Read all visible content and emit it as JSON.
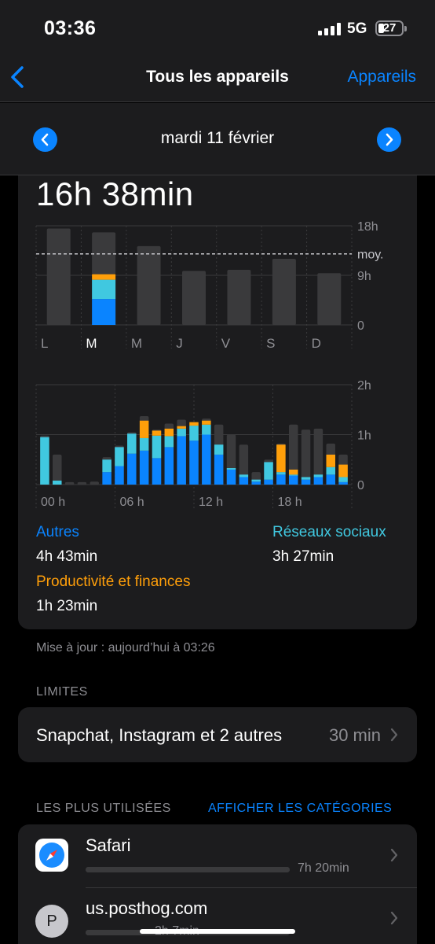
{
  "status": {
    "time": "03:36",
    "network": "5G",
    "battery": "27"
  },
  "nav": {
    "title": "Tous les appareils",
    "right": "Appareils"
  },
  "date": {
    "label": "mardi 11 février"
  },
  "summary": {
    "total": "16h 38min"
  },
  "weekly": {
    "y_ticks": [
      "18h",
      "9h",
      "0"
    ],
    "avg_label": "moy.",
    "days": [
      "L",
      "M",
      "M",
      "J",
      "V",
      "S",
      "D"
    ]
  },
  "hourly": {
    "y_ticks": [
      "2h",
      "1h",
      "0"
    ],
    "x_ticks": [
      "00 h",
      "06 h",
      "12 h",
      "18 h"
    ]
  },
  "legend": {
    "autres_label": "Autres",
    "autres_value": "4h 43min",
    "social_label": "Réseaux sociaux",
    "social_value": "3h 27min",
    "prod_label": "Productivité et finances",
    "prod_value": "1h 23min"
  },
  "updated": "Mise à jour : aujourd’hui à 03:26",
  "limits": {
    "header": "LIMITES",
    "text": "Snapchat, Instagram et 2 autres",
    "value": "30 min"
  },
  "most_used": {
    "header": "LES PLUS UTILISÉES",
    "link": "AFFICHER LES CATÉGORIES",
    "apps": [
      {
        "name": "Safari",
        "time": "7h 20min",
        "share": 1.0
      },
      {
        "name": "us.posthog.com",
        "time": "2h 7min",
        "share": 0.35,
        "initial": "P"
      }
    ]
  },
  "colors": {
    "accent": "#0a84ff",
    "blue": "#0a84ff",
    "cyan": "#40c8e0",
    "orange": "#ff9f0a",
    "gray": "#3a3a3c"
  },
  "chart_data": [
    {
      "type": "bar",
      "categories": [
        "L",
        "M",
        "M",
        "J",
        "V",
        "S",
        "D"
      ],
      "series": [
        {
          "values": [
            17.5,
            16.8,
            14.3,
            9.8,
            10.0,
            12.0,
            9.4
          ]
        }
      ],
      "highlight_index": 1,
      "highlight_breakdown": {
        "blue": 4.7,
        "cyan": 3.5,
        "orange": 1.0
      },
      "average": 12.9,
      "ylim": [
        0,
        18
      ],
      "y_ticks": [
        "18h",
        "9h",
        "0"
      ]
    },
    {
      "type": "bar",
      "categories": [
        "0",
        "1",
        "2",
        "3",
        "4",
        "5",
        "6",
        "7",
        "8",
        "9",
        "10",
        "11",
        "12",
        "13",
        "14",
        "15",
        "16",
        "17",
        "18",
        "19",
        "20",
        "21",
        "22",
        "23"
      ],
      "series": [
        {
          "name": "Autres",
          "values": [
            0,
            0,
            0,
            0,
            0,
            0,
            0,
            0,
            0.2,
            0.37,
            0.62,
            0.68,
            0.53,
            0.75,
            0.77,
            0.68,
            0.68,
            0.73,
            0.72,
            0.68,
            0.71,
            0.72,
            0.18,
            0.03,
            0.06,
            0.05,
            0,
            0,
            0,
            0,
            0,
            0.02,
            0.28,
            0.37,
            0.53,
            0.55,
            0.58,
            0.6,
            0.5,
            0.1,
            0.08,
            0.05,
            0.15,
            0.2,
            0.1,
            0.05,
            0.15,
            0.0
          ]
        },
        {
          "name": "Réseaux sociaux",
          "values": [
            0.6,
            0.25,
            0,
            0,
            0,
            0,
            0,
            0,
            0,
            0,
            0,
            0,
            0,
            0,
            0,
            0,
            0,
            0,
            0,
            0,
            0,
            0,
            0,
            0,
            0,
            0,
            0,
            0,
            0,
            0,
            0,
            0,
            0,
            0,
            0,
            0,
            0,
            0,
            0,
            0,
            0,
            0,
            0,
            0,
            0,
            0,
            0,
            0
          ]
        },
        {
          "name": "Productivité et finances",
          "values": [
            0,
            0,
            0,
            0,
            0,
            0,
            0,
            0,
            0,
            0,
            0,
            0,
            0,
            0,
            0,
            0,
            0,
            0,
            0,
            0,
            0,
            0,
            0,
            0,
            0,
            0,
            0,
            0,
            0,
            0,
            0,
            0,
            0,
            0,
            0,
            0,
            0,
            0,
            0,
            0,
            0,
            0,
            0,
            0,
            0,
            0,
            0,
            0
          ]
        }
      ],
      "ylim": [
        0,
        2
      ],
      "y_ticks": [
        "2h",
        "1h",
        "0"
      ],
      "x_ticks": [
        "00 h",
        "06 h",
        "12 h",
        "18 h"
      ]
    }
  ]
}
